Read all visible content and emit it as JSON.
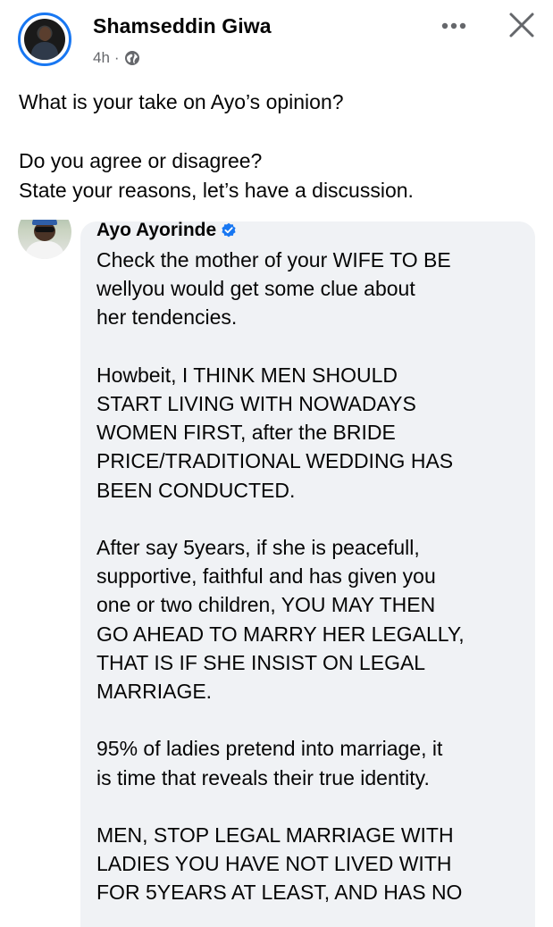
{
  "post": {
    "author": "Shamseddin Giwa",
    "time": "4h",
    "separator": "·",
    "privacy_icon": "globe-icon",
    "more_icon": "more-horizontal-icon",
    "close_icon": "close-icon",
    "text": [
      "What is your take on Ayo’s opinion?",
      "",
      "Do you agree or disagree?",
      "State your reasons, let’s have a discussion."
    ]
  },
  "comment": {
    "author": "Ayo Ayorinde",
    "verified_icon": "verified-badge-icon",
    "paragraphs": [
      [
        "Check the mother of your WIFE TO BE",
        "wellyou would get some clue about",
        "her tendencies."
      ],
      [
        "Howbeit, I THINK MEN SHOULD",
        "START LIVING WITH NOWADAYS",
        "WOMEN FIRST, after the BRIDE",
        "PRICE/TRADITIONAL WEDDING HAS",
        "BEEN CONDUCTED."
      ],
      [
        "After say 5years, if she is peacefull,",
        "supportive, faithful and has given you",
        "one or two children, YOU MAY THEN",
        "GO AHEAD TO MARRY HER LEGALLY,",
        "THAT IS IF SHE INSIST ON LEGAL",
        "MARRIAGE."
      ],
      [
        "95% of ladies pretend into marriage, it",
        "is time that reveals their true identity."
      ],
      [
        "MEN, STOP LEGAL MARRIAGE WITH",
        "LADIES YOU HAVE NOT LIVED WITH",
        "FOR 5YEARS AT LEAST, AND HAS NO"
      ]
    ]
  },
  "colors": {
    "accent": "#1877f2",
    "bubble": "#f0f2f5",
    "meta_text": "#65676b",
    "text": "#050505"
  }
}
